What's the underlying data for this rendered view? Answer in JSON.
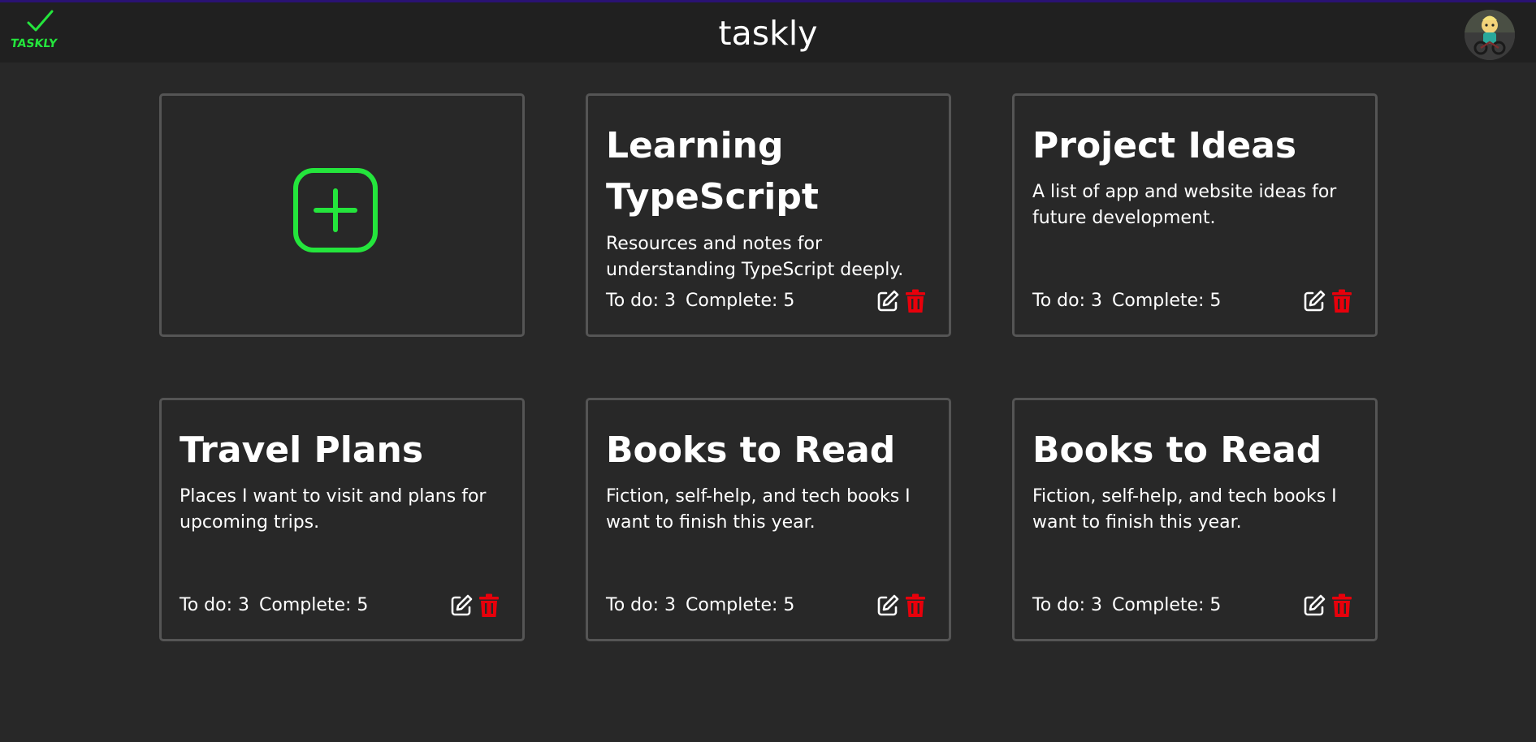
{
  "header": {
    "title": "taskly",
    "logo_text": "TASKLY",
    "avatar_alt": "User avatar"
  },
  "add_card": {
    "icon": "plus-square-icon"
  },
  "cards": [
    {
      "title": "Learning TypeScript",
      "description": "Resources and notes for understanding TypeScript deeply.",
      "todo": "To do: 3",
      "complete": "Complete: 5"
    },
    {
      "title": "Project Ideas",
      "description": "A list of app and website ideas for future development.",
      "todo": "To do: 3",
      "complete": "Complete: 5"
    },
    {
      "title": "Travel Plans",
      "description": "Places I want to visit and plans for upcoming trips.",
      "todo": "To do: 3",
      "complete": "Complete: 5"
    },
    {
      "title": "Books to Read",
      "description": "Fiction, self-help, and tech books I want to finish this year.",
      "todo": "To do: 3",
      "complete": "Complete: 5"
    },
    {
      "title": "Books to Read",
      "description": "Fiction, self-help, and tech books I want to finish this year.",
      "todo": "To do: 3",
      "complete": "Complete: 5"
    }
  ],
  "colors": {
    "background": "#282828",
    "topbar": "#202020",
    "accent_green": "#24e53c",
    "delete_red": "#e8000b",
    "card_border": "#555555"
  }
}
